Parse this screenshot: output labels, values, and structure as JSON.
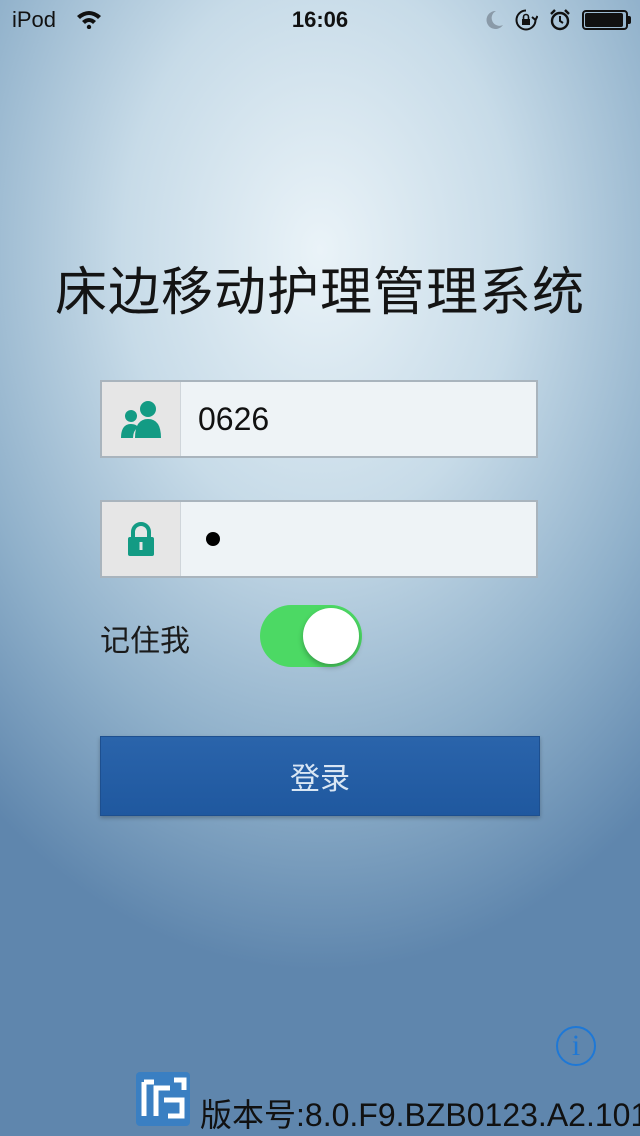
{
  "status_bar": {
    "carrier": "iPod",
    "time": "16:06",
    "icons": [
      "wifi-icon",
      "moon-icon",
      "rotation-lock-icon",
      "alarm-icon",
      "battery-icon"
    ]
  },
  "title": "床边移动护理管理系统",
  "username": {
    "icon": "user-icon",
    "value": "0626"
  },
  "password": {
    "icon": "lock-icon",
    "masked_length": 1
  },
  "remember_me": {
    "label": "记住我",
    "checked": true
  },
  "login_button": {
    "label": "登录"
  },
  "info_button": {
    "label": "i"
  },
  "footer": {
    "logo_icon": "app-logo-icon",
    "version": "版本号:8.0.F9.BZB0123.A2.101"
  },
  "colors": {
    "accent_green": "#139b84",
    "toggle_on": "#4cd964",
    "button_blue": "#2560a6",
    "info_blue": "#1e78d6"
  }
}
